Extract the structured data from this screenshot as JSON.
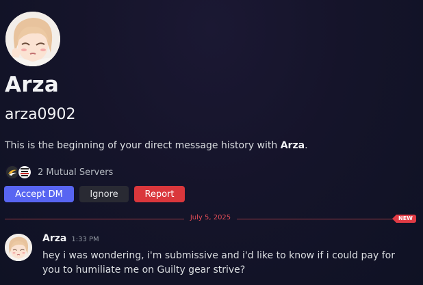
{
  "profile": {
    "display_name": "Arza",
    "username": "arza0902"
  },
  "intro": {
    "text_before": "This is the beginning of your direct message history with ",
    "name": "Arza",
    "text_after": "."
  },
  "mutual_servers": {
    "label": "2 Mutual Servers",
    "icons": [
      "server-icon-swoosh",
      "server-icon-guilty-gear-strive"
    ]
  },
  "actions": {
    "accept_label": "Accept DM",
    "ignore_label": "Ignore",
    "report_label": "Report"
  },
  "divider": {
    "date": "July 5, 2025",
    "badge": "NEW"
  },
  "message": {
    "author": "Arza",
    "time": "1:33 PM",
    "text": "hey i was wondering, i'm submissive and i'd like to know if i could pay for you to humiliate me on Guilty gear strive?"
  },
  "colors": {
    "accept": "#5865f2",
    "ignore": "#292a33",
    "report": "#da373c",
    "divider": "#e13b45"
  }
}
